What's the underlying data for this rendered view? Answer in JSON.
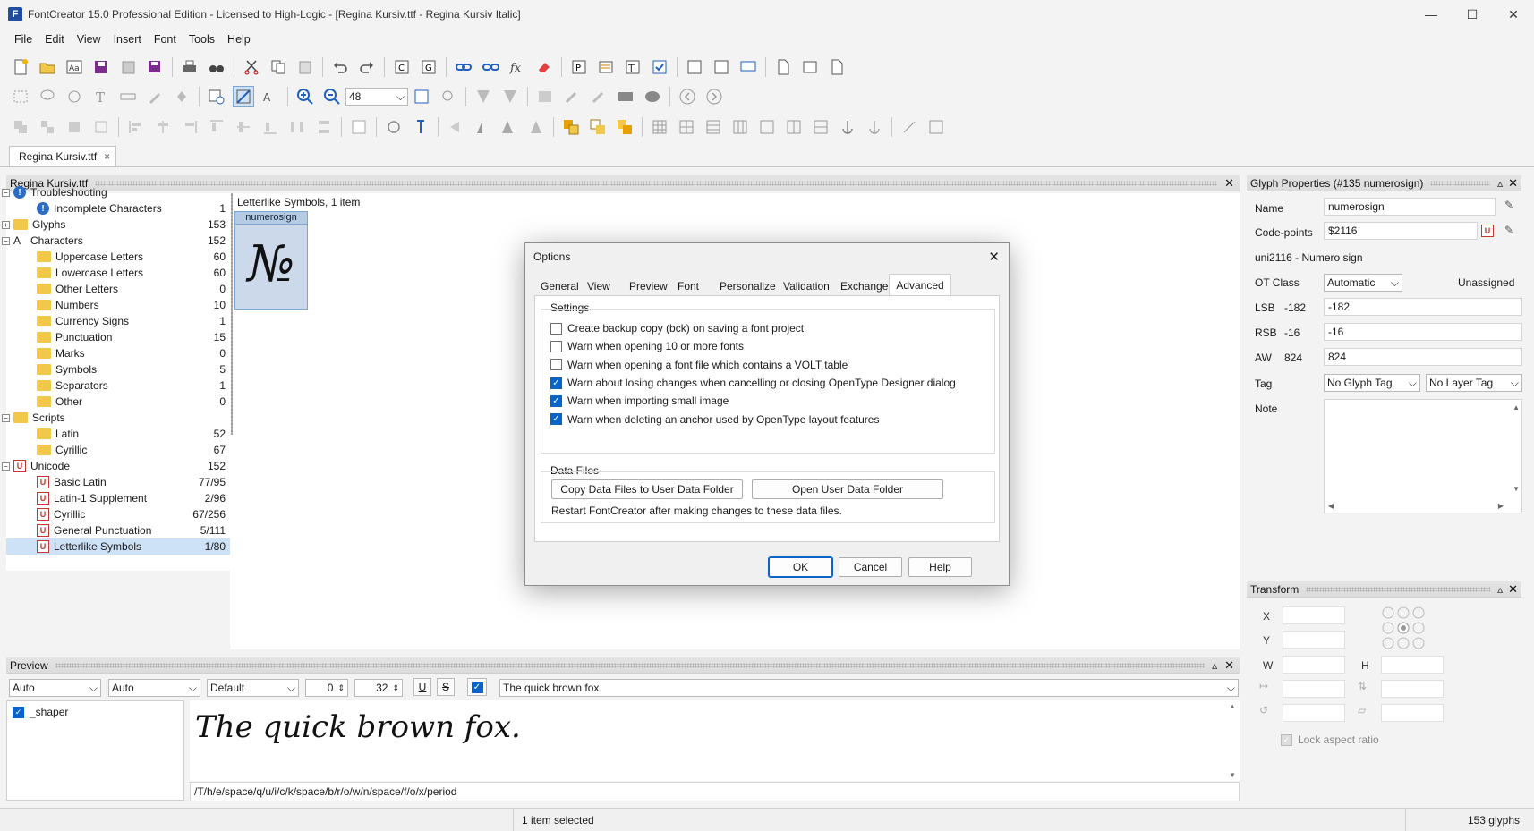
{
  "window": {
    "title": "FontCreator 15.0 Professional Edition - Licensed to High-Logic - [Regina Kursiv.ttf - Regina Kursiv Italic]",
    "app_icon_letter": "F"
  },
  "menu": [
    "File",
    "Edit",
    "View",
    "Insert",
    "Font",
    "Tools",
    "Help"
  ],
  "toolbar": {
    "zoom_value": "48"
  },
  "doc_tab": {
    "label": "Regina Kursiv.ttf",
    "close": "×"
  },
  "explorer": {
    "title": "Regina Kursiv.ttf",
    "items": [
      {
        "label": "Troubleshooting",
        "count": "",
        "depth": 0,
        "icon": "info-icon",
        "exp": "−"
      },
      {
        "label": "Incomplete Characters",
        "count": "1",
        "depth": 1,
        "icon": "info-icon"
      },
      {
        "label": "Glyphs",
        "count": "153",
        "depth": 0,
        "icon": "folder-icon",
        "exp": "+"
      },
      {
        "label": "Characters",
        "count": "152",
        "depth": 0,
        "icon": "letter-a-icon",
        "exp": "−"
      },
      {
        "label": "Uppercase Letters",
        "count": "60",
        "depth": 1,
        "icon": "folder-icon"
      },
      {
        "label": "Lowercase Letters",
        "count": "60",
        "depth": 1,
        "icon": "folder-icon"
      },
      {
        "label": "Other Letters",
        "count": "0",
        "depth": 1,
        "icon": "folder-icon"
      },
      {
        "label": "Numbers",
        "count": "10",
        "depth": 1,
        "icon": "folder-icon"
      },
      {
        "label": "Currency Signs",
        "count": "1",
        "depth": 1,
        "icon": "folder-icon"
      },
      {
        "label": "Punctuation",
        "count": "15",
        "depth": 1,
        "icon": "folder-icon"
      },
      {
        "label": "Marks",
        "count": "0",
        "depth": 1,
        "icon": "folder-icon"
      },
      {
        "label": "Symbols",
        "count": "5",
        "depth": 1,
        "icon": "folder-icon"
      },
      {
        "label": "Separators",
        "count": "1",
        "depth": 1,
        "icon": "folder-icon"
      },
      {
        "label": "Other",
        "count": "0",
        "depth": 1,
        "icon": "folder-icon"
      },
      {
        "label": "Scripts",
        "count": "",
        "depth": 0,
        "icon": "folder-icon",
        "exp": "−"
      },
      {
        "label": "Latin",
        "count": "52",
        "depth": 1,
        "icon": "folder-icon"
      },
      {
        "label": "Cyrillic",
        "count": "67",
        "depth": 1,
        "icon": "folder-icon"
      },
      {
        "label": "Unicode",
        "count": "152",
        "depth": 0,
        "icon": "unicode-icon",
        "exp": "−"
      },
      {
        "label": "Basic Latin",
        "count": "77/95",
        "depth": 1,
        "icon": "unicode-icon"
      },
      {
        "label": "Latin-1 Supplement",
        "count": "2/96",
        "depth": 1,
        "icon": "unicode-icon"
      },
      {
        "label": "Cyrillic",
        "count": "67/256",
        "depth": 1,
        "icon": "unicode-icon"
      },
      {
        "label": "General Punctuation",
        "count": "5/111",
        "depth": 1,
        "icon": "unicode-icon"
      },
      {
        "label": "Letterlike Symbols",
        "count": "1/80",
        "depth": 1,
        "icon": "unicode-icon",
        "selected": true
      }
    ]
  },
  "grid": {
    "caption": "Letterlike Symbols, 1 item",
    "glyph_name": "numerosign",
    "glyph_char": "№"
  },
  "dialog": {
    "title": "Options",
    "tabs": [
      "General",
      "View",
      "Preview",
      "Font",
      "Personalize",
      "Validation",
      "Exchange",
      "Advanced"
    ],
    "active_tab": "Advanced",
    "settings_label": "Settings",
    "settings": [
      {
        "label": "Create backup copy (bck) on saving a font project",
        "checked": false
      },
      {
        "label": "Warn when opening 10 or more fonts",
        "checked": false
      },
      {
        "label": "Warn when opening a font file which contains a VOLT table",
        "checked": false
      },
      {
        "label": "Warn about losing changes when cancelling or closing OpenType Designer dialog",
        "checked": true
      },
      {
        "label": "Warn when importing small image",
        "checked": true
      },
      {
        "label": "Warn when deleting an anchor used by OpenType layout features",
        "checked": true
      }
    ],
    "datafiles_label": "Data Files",
    "copy_btn": "Copy Data Files to User Data Folder",
    "open_btn": "Open User Data Folder",
    "restart_note": "Restart FontCreator after making changes to these data files.",
    "ok": "OK",
    "cancel": "Cancel",
    "help": "Help"
  },
  "glyph_props": {
    "title": "Glyph Properties (#135 numerosign)",
    "name_label": "Name",
    "name_value": "numerosign",
    "cp_label": "Code-points",
    "cp_value": "$2116",
    "uni_desc": "uni2116 - Numero sign",
    "otclass_label": "OT Class",
    "otclass_value": "Automatic",
    "otclass_status": "Unassigned",
    "lsb_label": "LSB",
    "lsb_num": "-182",
    "lsb_value": "-182",
    "rsb_label": "RSB",
    "rsb_num": "-16",
    "rsb_value": "-16",
    "aw_label": "AW",
    "aw_num": "824",
    "aw_value": "824",
    "tag_label": "Tag",
    "glyph_tag": "No Glyph Tag",
    "layer_tag": "No Layer Tag",
    "note_label": "Note"
  },
  "transform": {
    "title": "Transform",
    "x": "X",
    "y": "Y",
    "w": "W",
    "h": "H",
    "lock": "Lock aspect ratio"
  },
  "preview": {
    "title": "Preview",
    "combo1": "Auto",
    "combo2": "Auto",
    "combo3": "Default",
    "spin1": "0",
    "spin2": "32",
    "text": "The quick brown fox.",
    "shaper_label": "_shaper",
    "glyph_string": "/T/h/e/space/q/u/i/c/k/space/b/r/o/w/n/space/f/o/x/period"
  },
  "status": {
    "selected": "1 item selected",
    "glyphs": "153 glyphs"
  }
}
